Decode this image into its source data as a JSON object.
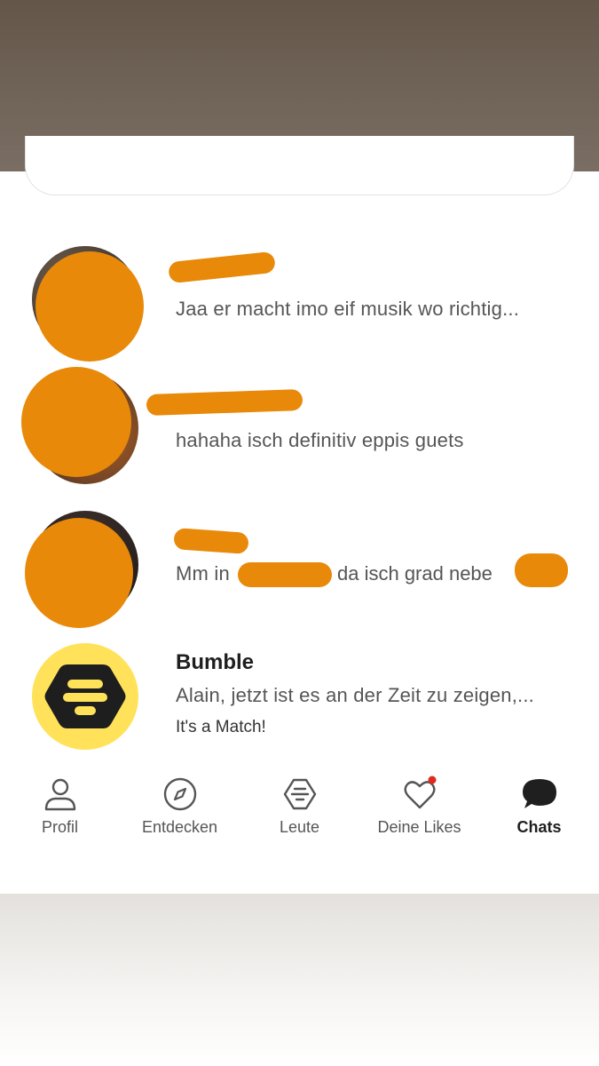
{
  "chats": [
    {
      "preview": "Jaa er macht imo eif musik wo richtig..."
    },
    {
      "preview": "hahaha isch definitiv eppis guets"
    },
    {
      "preview_start": "Mm in",
      "preview_mid": "da isch grad nebe"
    },
    {
      "name": "Bumble",
      "preview": "Alain, jetzt ist es an der Zeit zu zeigen,...",
      "subline": "It's a Match!"
    }
  ],
  "nav": {
    "profil": "Profil",
    "entdecken": "Entdecken",
    "leute": "Leute",
    "likes": "Deine Likes",
    "chats": "Chats"
  },
  "colors": {
    "redaction": "#e8890a",
    "bumble_yellow": "#ffe25a",
    "notification_dot": "#e0291f"
  },
  "icons": {
    "profil": "person-icon",
    "entdecken": "compass-icon",
    "leute": "hexagon-icon",
    "likes": "heart-icon",
    "chats": "chat-bubble-icon"
  }
}
